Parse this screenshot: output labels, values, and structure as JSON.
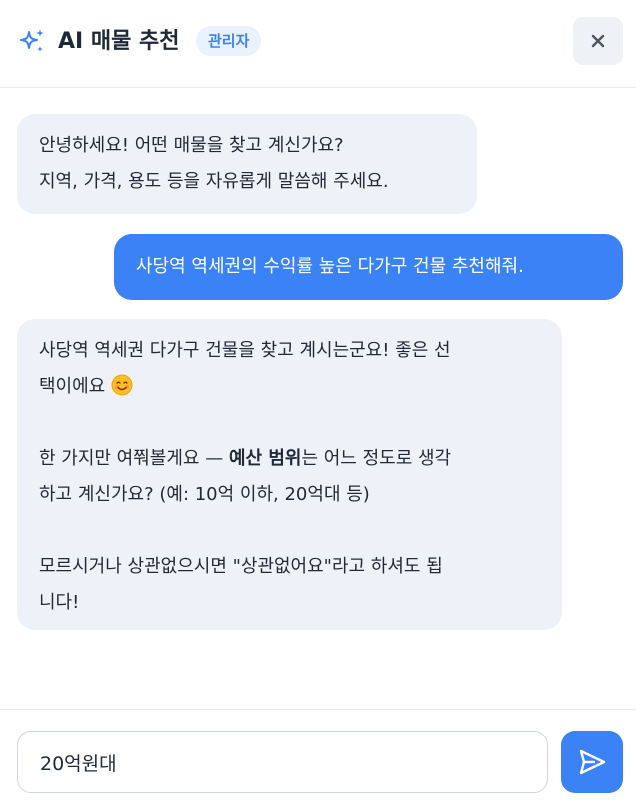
{
  "header": {
    "title": "AI 매물 추천",
    "badge": "관리자",
    "title_icon": "sparkle-icon",
    "close_icon": "close-icon"
  },
  "messages": [
    {
      "role": "assistant",
      "lines": [
        "안녕하세요! 어떤 매물을 찾고 계신가요?",
        "지역, 가격, 용도 등을 자유롭게 말씀해 주세요."
      ]
    },
    {
      "role": "user",
      "text": "사당역 역세권의 수익률 높은 다가구 건물 추천해줘."
    },
    {
      "role": "assistant",
      "p1_line1": "사당역 역세권 다가구 건물을 찾고 계시는군요! 좋은 선",
      "p1_line2": "택이에요",
      "p1_emoji": "smiling-face-icon",
      "p2_line1_pre": "한 가지만 여쭤볼게요 — ",
      "p2_line1_bold": "예산 범위",
      "p2_line1_post": "는 어느 정도로 생각",
      "p2_line2": "하고 계신가요? (예: 10억 이하, 20억대 등)",
      "p3_line1": "모르시거나 상관없으시면 \"상관없어요\"라고 하셔도 됩",
      "p3_line2": "니다!"
    }
  ],
  "composer": {
    "value": "20억원대",
    "send_icon": "send-icon"
  },
  "colors": {
    "accent": "#3b82f6",
    "assistant_bubble": "#eef2f8",
    "badge_bg": "#eaf2fd"
  }
}
